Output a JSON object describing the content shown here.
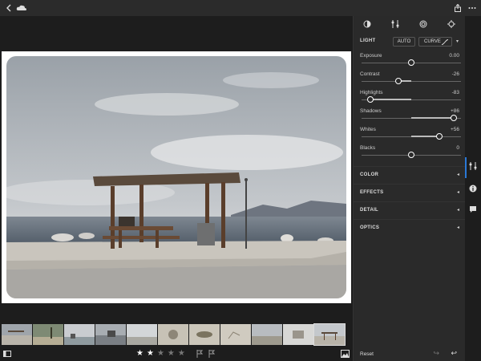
{
  "topbar": {
    "back_icon": "chevron-left-icon",
    "cloud_icon": "cloud-sync-icon",
    "share_icon": "share-icon",
    "more_icon": "more-icon"
  },
  "panel": {
    "tabs": [
      "presets-icon",
      "edit-sliders-icon",
      "mask-icon",
      "heal-icon"
    ],
    "light": {
      "label": "LIGHT",
      "auto_label": "AUTO",
      "curve_label": "CURVE"
    },
    "sliders": [
      {
        "label": "Exposure",
        "value": "0.00",
        "level": 0.5
      },
      {
        "label": "Contrast",
        "value": "-26",
        "level": 0.37
      },
      {
        "label": "Highlights",
        "value": "-83",
        "level": 0.085
      },
      {
        "label": "Shadows",
        "value": "+86",
        "level": 0.93
      },
      {
        "label": "Whites",
        "value": "+56",
        "level": 0.78
      },
      {
        "label": "Blacks",
        "value": "0",
        "level": 0.5
      }
    ],
    "sections": [
      {
        "label": "COLOR"
      },
      {
        "label": "EFFECTS"
      },
      {
        "label": "DETAIL"
      },
      {
        "label": "OPTICS"
      }
    ],
    "reset_label": "Reset"
  },
  "bottombar": {
    "rating": 2,
    "max_rating": 5
  },
  "colors": {
    "accent": "#2a78d6",
    "panel_bg": "#2a2a2a",
    "app_bg": "#1d1d1d"
  }
}
